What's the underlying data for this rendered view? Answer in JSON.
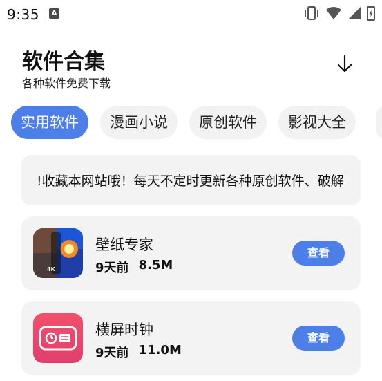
{
  "status_bar": {
    "time": "9:35",
    "notification_icon": "a-icon",
    "icons": [
      "vibrate-icon",
      "wifi-icon",
      "signal-icon",
      "battery-charging-icon"
    ]
  },
  "header": {
    "title": "软件合集",
    "subtitle": "各种软件免费下载",
    "download_icon": "arrow-down-icon"
  },
  "tabs": [
    {
      "label": "实用软件",
      "active": true
    },
    {
      "label": "漫画小说",
      "active": false
    },
    {
      "label": "原创软件",
      "active": false
    },
    {
      "label": "影视大全",
      "active": false
    }
  ],
  "notice": {
    "text": "!收藏本网站哦！每天不定时更新各种原创软件、破解"
  },
  "apps": [
    {
      "name": "壁纸专家",
      "age": "9天前",
      "size": "8.5M",
      "button": "查看",
      "icon": "wallpaper-app-icon"
    },
    {
      "name": "横屏时钟",
      "age": "9天前",
      "size": "11.0M",
      "button": "查看",
      "icon": "clock-app-icon"
    }
  ],
  "colors": {
    "accent": "#4c7fe8",
    "card_bg": "#f3f3f4",
    "clock_icon_top": "#f0506a",
    "clock_icon_bottom": "#e23f6f"
  }
}
